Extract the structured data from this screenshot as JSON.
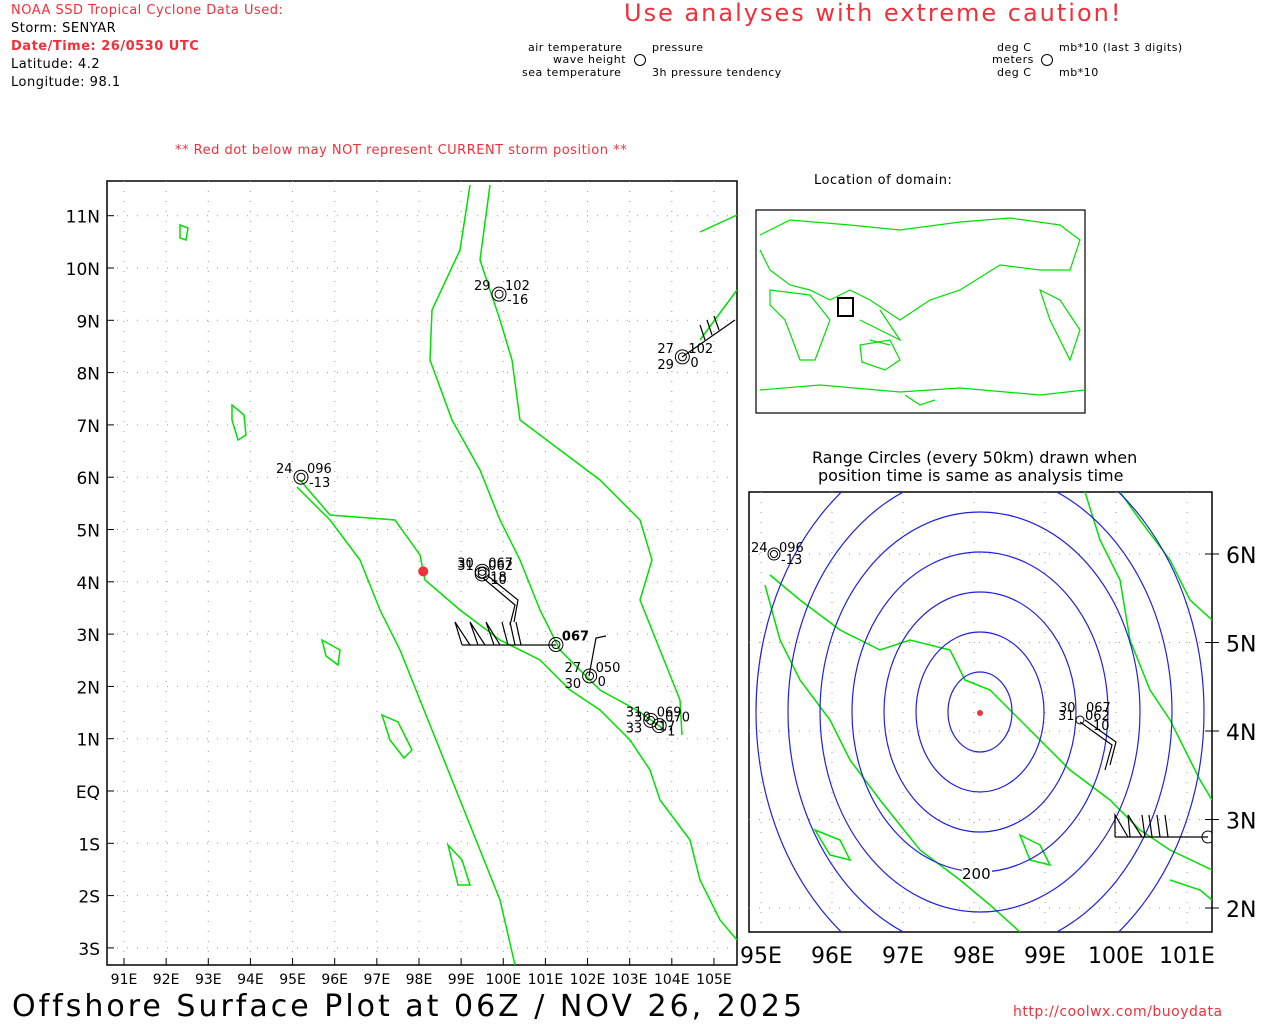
{
  "header": {
    "source": "NOAA SSD Tropical Cyclone Data Used:",
    "storm": "Storm: SENYAR",
    "datetime": "Date/Time: 26/0530 UTC",
    "latitude": "Latitude: 4.2",
    "longitude": "Longitude: 98.1",
    "caution": "Use analyses with extreme caution!",
    "red_dot_note": "** Red dot below may NOT represent CURRENT storm position **"
  },
  "legend": {
    "left": {
      "air_temp": "air temperature",
      "pressure": "pressure",
      "wave": "wave height",
      "sea_temp": "sea temperature",
      "tendency": "3h pressure tendency"
    },
    "right": {
      "air_unit": "deg C",
      "pressure_unit": "mb*10 (last 3 digits)",
      "wave_unit": "meters",
      "sea_unit": "deg C",
      "tendency_unit": "mb*10"
    }
  },
  "main_map": {
    "lat_labels": [
      "11N",
      "10N",
      "9N",
      "8N",
      "7N",
      "6N",
      "5N",
      "4N",
      "3N",
      "2N",
      "1N",
      "EQ",
      "1S",
      "2S",
      "3S"
    ],
    "lon_labels": [
      "91E",
      "92E",
      "93E",
      "94E",
      "95E",
      "96E",
      "97E",
      "98E",
      "99E",
      "100E",
      "101E",
      "102E",
      "103E",
      "104E",
      "105E"
    ],
    "storm": {
      "lat": 4.2,
      "lon": 98.1
    },
    "stations": [
      {
        "lat": 9.5,
        "lon": 99.9,
        "tl": "29",
        "tr": "102",
        "br": "-16"
      },
      {
        "lat": 6.0,
        "lon": 95.2,
        "tl": "24",
        "tr": "096",
        "br": "-13"
      },
      {
        "lat": 8.3,
        "lon": 104.25,
        "tl": "27",
        "tr": "102",
        "bl": "29",
        "br": "0"
      },
      {
        "lat": 4.15,
        "lon": 99.5,
        "tl": "31",
        "tr": "062",
        "br": "10"
      },
      {
        "lat": 4.2,
        "lon": 99.5,
        "tl": "30",
        "tr": "067",
        "br": "18"
      },
      {
        "lat": 2.8,
        "lon": 101.25,
        "tr": "067"
      },
      {
        "lat": 2.2,
        "lon": 102.05,
        "tl": "27",
        "tr": "050",
        "bl": "30",
        "br": "0"
      },
      {
        "lat": 1.35,
        "lon": 103.5,
        "tl": "31",
        "tr": "069",
        "bl": "33",
        "br": "17"
      },
      {
        "lat": 1.25,
        "lon": 103.7,
        "tl": "30",
        "tr": "070",
        "br": "1"
      }
    ]
  },
  "domain_map": {
    "title": "Location of domain:"
  },
  "range_map": {
    "title_line1": "Range Circles (every 50km) drawn when",
    "title_line2": "position time is same as analysis time",
    "ring_label": "200",
    "lat_labels": [
      "6N",
      "5N",
      "4N",
      "3N",
      "2N"
    ],
    "lon_labels": [
      "95E",
      "96E",
      "97E",
      "98E",
      "99E",
      "100E",
      "101E"
    ]
  },
  "footer": {
    "title": "Offshore Surface Plot at 06Z / NOV 26, 2025",
    "url": "http://coolwx.com/buoydata"
  },
  "colors": {
    "land": "#00e000",
    "storm": "#f0303a",
    "rings": "#2020e0"
  }
}
